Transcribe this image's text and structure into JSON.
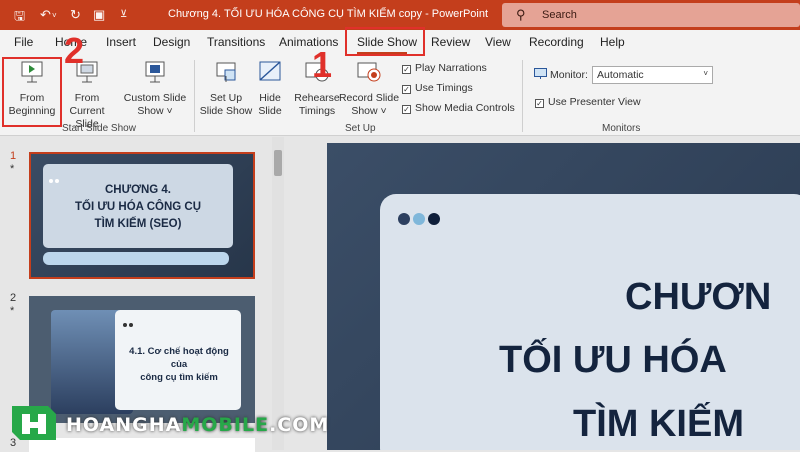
{
  "titlebar": {
    "doc_title": "Chương 4. TỐI ƯU HÓA CÔNG CỤ  TÌM KIẾM copy  -  PowerPoint",
    "search_placeholder": "Search"
  },
  "tabs": [
    "File",
    "Home",
    "Insert",
    "Design",
    "Transitions",
    "Animations",
    "Slide Show",
    "Review",
    "View",
    "Recording",
    "Help"
  ],
  "active_tab": "Slide Show",
  "ribbon": {
    "start_group": {
      "label": "Start Slide Show",
      "from_beginning": [
        "From",
        "Beginning"
      ],
      "from_current": [
        "From",
        "Current Slide"
      ],
      "custom": [
        "Custom Slide",
        "Show ˅"
      ]
    },
    "setup_group": {
      "label": "Set Up",
      "setup_show": [
        "Set Up",
        "Slide Show"
      ],
      "hide_slide": [
        "Hide",
        "Slide"
      ],
      "rehearse": [
        "Rehearse",
        "Timings"
      ],
      "record": [
        "Record Slide",
        "Show ˅"
      ],
      "play_narrations": "Play Narrations",
      "use_timings": "Use Timings",
      "show_media_controls": "Show Media Controls"
    },
    "monitors_group": {
      "label": "Monitors",
      "monitor_label": "Monitor:",
      "monitor_value": "Automatic",
      "use_presenter_view": "Use Presenter View"
    }
  },
  "slides": {
    "numbers": [
      "1",
      "2",
      "3"
    ],
    "star": "*",
    "slide1_title": [
      "CHƯƠNG 4.",
      "TỐI ƯU HÓA CÔNG CỤ",
      "TÌM KIẾM (SEO)"
    ],
    "slide2_title": [
      "4.1. Cơ chế hoạt động của",
      "công cụ tìm kiếm"
    ]
  },
  "main_slide": {
    "lines": [
      "CHƯƠN",
      "TỐI ƯU HÓA",
      "TÌM KIẾM"
    ]
  },
  "annotations": {
    "step1": "1",
    "step2": "2"
  },
  "watermark": {
    "brand_a": "HOANGHA",
    "brand_b": "MOBILE",
    "brand_c": ".COM"
  },
  "colors": {
    "accent": "#c43e1c",
    "annotation_red": "#e0302a",
    "slide_dark": "#2f3f55",
    "dot_colors": [
      "#2c3f5f",
      "#7fb7da",
      "#0f1f3a"
    ]
  }
}
